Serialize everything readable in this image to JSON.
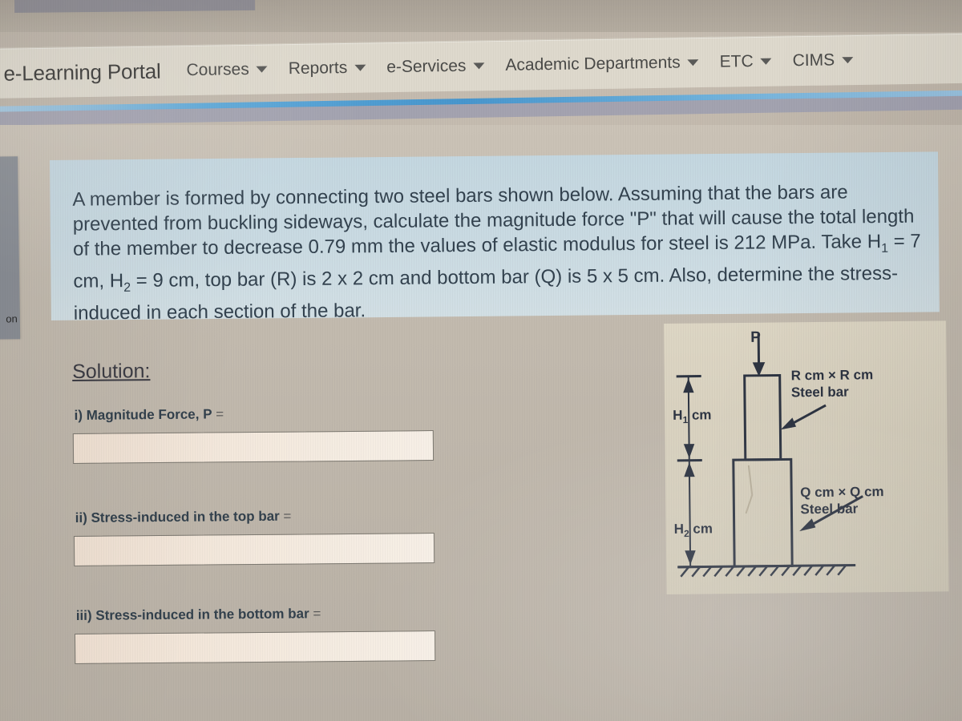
{
  "nav": {
    "brand": "e-Learning Portal",
    "items": [
      {
        "label": "Courses",
        "has_caret": true
      },
      {
        "label": "Reports",
        "has_caret": true
      },
      {
        "label": "e-Services",
        "has_caret": true
      },
      {
        "label": "Academic Departments",
        "has_caret": true
      },
      {
        "label": "ETC",
        "has_caret": true
      },
      {
        "label": "CIMS",
        "has_caret": true
      }
    ]
  },
  "sidebar": {
    "visible_label": "on"
  },
  "question": {
    "line1": "A member is formed by connecting two steel bars shown below. Assuming that the bars",
    "line2": "are prevented from buckling sideways, calculate the magnitude force \"P\" that will cause",
    "line3": "the total length of the member to decrease 0.79 mm the values of elastic modulus for",
    "line4_a": "steel is 212 MPa. Take H",
    "line4_sub1": "1",
    "line4_b": " = 7 cm, H",
    "line4_sub2": "2",
    "line4_c": " = 9 cm, top bar (R) is 2 x 2 cm and bottom bar",
    "line5": "(Q) is 5 x 5 cm. Also, determine the stress-induced in each section of the bar.",
    "values": {
      "decrease_mm": "0.79 mm",
      "elastic_modulus": "212 MPa",
      "H1": "7 cm",
      "H2": "9 cm",
      "top_bar_R": "2 x 2 cm",
      "bottom_bar_Q": "5 x 5 cm"
    }
  },
  "solution": {
    "heading": "Solution:",
    "items": [
      {
        "label_text": "i) Magnitude Force, P",
        "eq": " =",
        "answer": ""
      },
      {
        "label_text": "ii) Stress-induced in the top bar",
        "eq": " =",
        "answer": ""
      },
      {
        "label_text": "iii) Stress-induced in the bottom bar",
        "eq": " =",
        "answer": ""
      }
    ]
  },
  "figure": {
    "load_label": "P",
    "h1_label": "H",
    "h1_sub": "1",
    "h1_unit": " cm",
    "h2_label": "H",
    "h2_sub": "2",
    "h2_unit": " cm",
    "top_bar_note_line1": "R cm × R cm",
    "top_bar_note_line2": "Steel bar",
    "bottom_bar_note_line1": "Q cm ×   Q cm",
    "bottom_bar_note_line2": "Steel bar"
  },
  "colors": {
    "nav_bg": "#ded9cd",
    "accent_blue": "#3d93d0",
    "question_panel": "#c9dae2",
    "answer_box": "#f3e8dc",
    "figure_bg": "#d7d0be",
    "ink": "#2d3442"
  }
}
